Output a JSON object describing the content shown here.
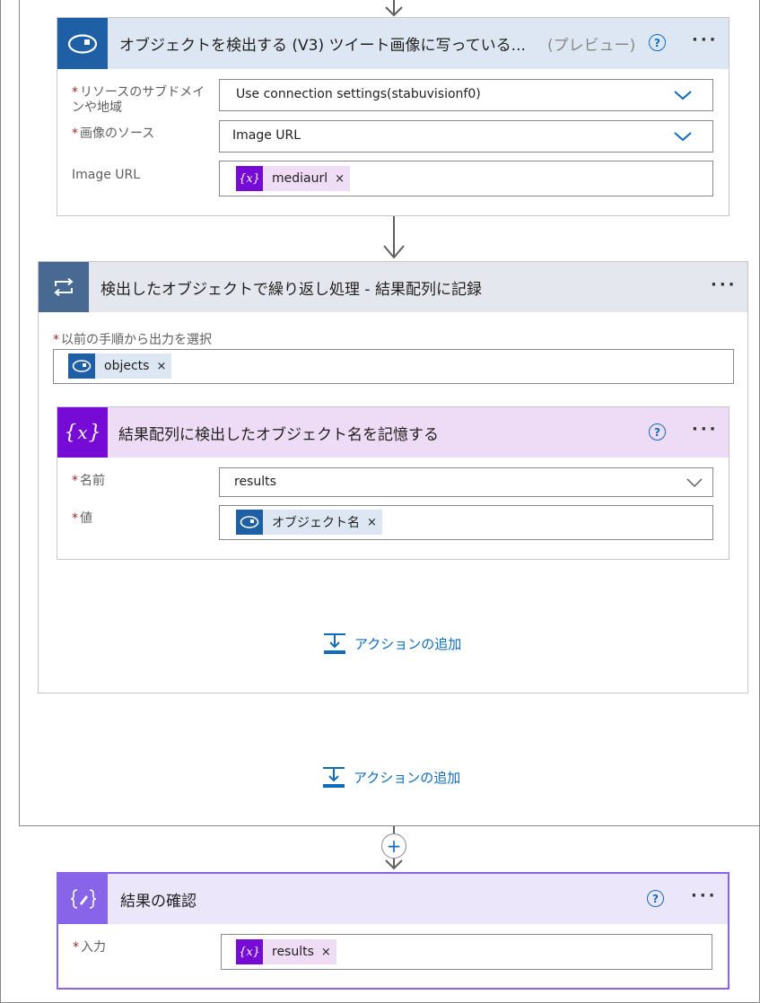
{
  "detect_card": {
    "title": "オブジェクトを検出する (V3) ツイート画像に写っている...",
    "preview": "(プレビュー)",
    "help": "?",
    "more": "···",
    "icon": "eye-icon",
    "color": "#1f5fa6",
    "fields": [
      {
        "label": "リソースのサブドメインや地域",
        "label_line1": "リソースのサブドメイ",
        "label_line2": "ンや地域",
        "required": true,
        "value": "Use connection settings(stabuvisionf0)",
        "type": "dropdown"
      },
      {
        "label": "画像のソース",
        "required": true,
        "value": "Image URL",
        "type": "dropdown"
      },
      {
        "label": "Image URL",
        "required": false,
        "token": "mediaurl",
        "token_icon": "variable-icon",
        "type": "token"
      }
    ]
  },
  "loop_card": {
    "title": "検出したオブジェクトで繰り返し処理 - 結果配列に記録",
    "more": "···",
    "icon": "loop-icon",
    "color": "#486991",
    "select_label": "以前の手順から出力を選択",
    "select_token": "objects",
    "select_token_icon": "eye-icon",
    "add_action": "アクションの追加"
  },
  "append_card": {
    "title": "結果配列に検出したオブジェクト名を記憶する",
    "help": "?",
    "more": "···",
    "icon": "variable-icon",
    "color": "#770bd6",
    "name_label": "名前",
    "name_value": "results",
    "value_label": "値",
    "value_token": "オブジェクト名",
    "value_token_icon": "eye-icon"
  },
  "outer_add_action": "アクションの追加",
  "plus": "+",
  "result_card": {
    "title": "結果の確認",
    "help": "?",
    "more": "···",
    "icon": "compose-icon",
    "color": "#8764e8",
    "input_label": "入力",
    "input_token": "results",
    "input_token_icon": "variable-icon"
  },
  "token_remove": "×",
  "required_mark": "*"
}
